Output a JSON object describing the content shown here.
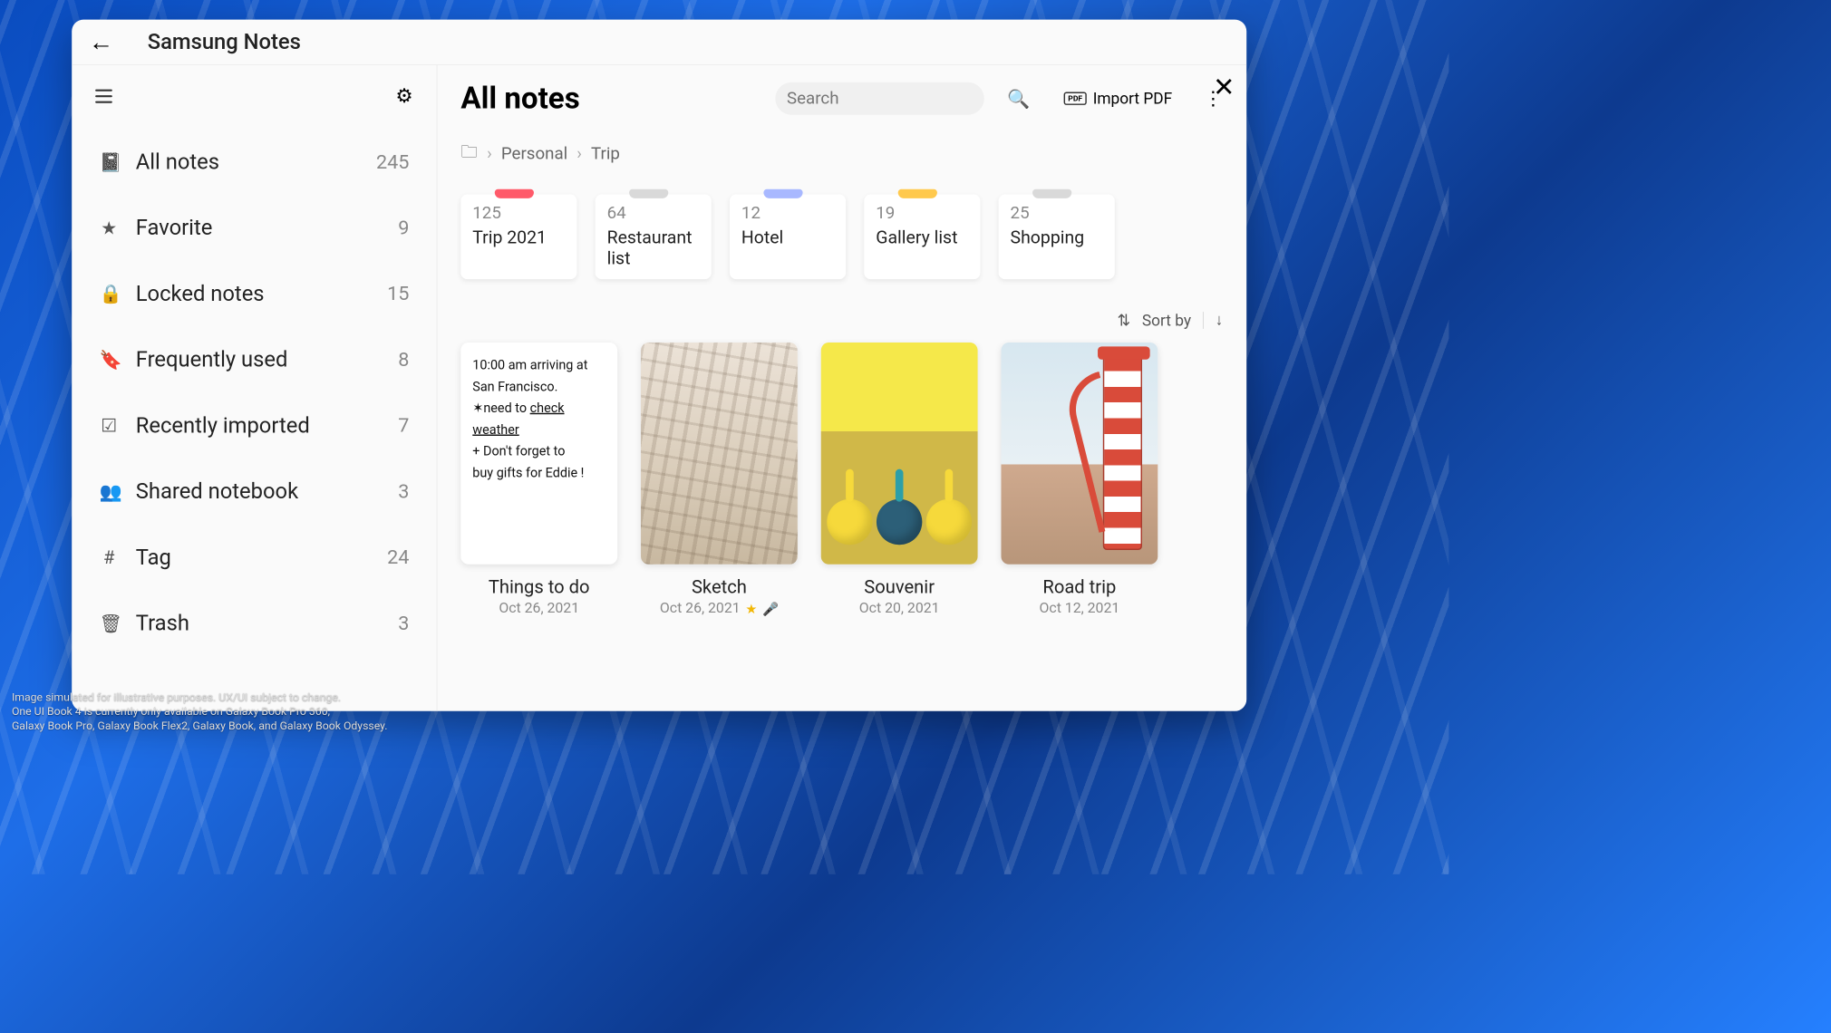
{
  "app": {
    "title": "Samsung Notes"
  },
  "sidebar": {
    "items": [
      {
        "icon": "📓",
        "label": "All notes",
        "count": "245"
      },
      {
        "icon": "★",
        "label": "Favorite",
        "count": "9"
      },
      {
        "icon": "🔒",
        "label": "Locked notes",
        "count": "15"
      },
      {
        "icon": "🔖",
        "label": "Frequently used",
        "count": "8"
      },
      {
        "icon": "☑",
        "label": "Recently imported",
        "count": "7"
      },
      {
        "icon": "👥",
        "label": "Shared notebook",
        "count": "3"
      },
      {
        "icon": "#",
        "label": "Tag",
        "count": "24"
      },
      {
        "icon": "🗑",
        "label": "Trash",
        "count": "3"
      }
    ]
  },
  "main": {
    "title": "All notes",
    "search_placeholder": "Search",
    "import_label": "Import PDF",
    "breadcrumb": {
      "root_icon": "🗀",
      "p1": "Personal",
      "p2": "Trip"
    },
    "sort_label": "Sort by"
  },
  "folders": [
    {
      "count": "125",
      "name": "Trip 2021",
      "color": "#ff5a6a"
    },
    {
      "count": "64",
      "name": "Restaurant list",
      "color": "#d9d9d9"
    },
    {
      "count": "12",
      "name": "Hotel",
      "color": "#a8b8ff"
    },
    {
      "count": "19",
      "name": "Gallery list",
      "color": "#ffc94d"
    },
    {
      "count": "25",
      "name": "Shopping",
      "color": "#d9d9d9"
    }
  ],
  "notes": [
    {
      "title": "Things to do",
      "date": "Oct 26, 2021",
      "text_lines": [
        "10:00 am arriving at",
        "San Francisco.",
        "✶need to ",
        "check weather",
        "+ Don't forget to",
        "buy gifts for Eddie !"
      ]
    },
    {
      "title": "Sketch",
      "date": "Oct 26, 2021",
      "favorite": true,
      "voice": true
    },
    {
      "title": "Souvenir",
      "date": "Oct 20, 2021"
    },
    {
      "title": "Road trip",
      "date": "Oct 12, 2021"
    }
  ],
  "disclaimer": {
    "l1": "Image simulated for illustrative purposes. UX/UI subject to change.",
    "l2": "One UI Book 4 is currently only available on Galaxy Book Pro 360,",
    "l3": "Galaxy Book Pro, Galaxy Book Flex2, Galaxy Book, and Galaxy Book Odyssey."
  }
}
